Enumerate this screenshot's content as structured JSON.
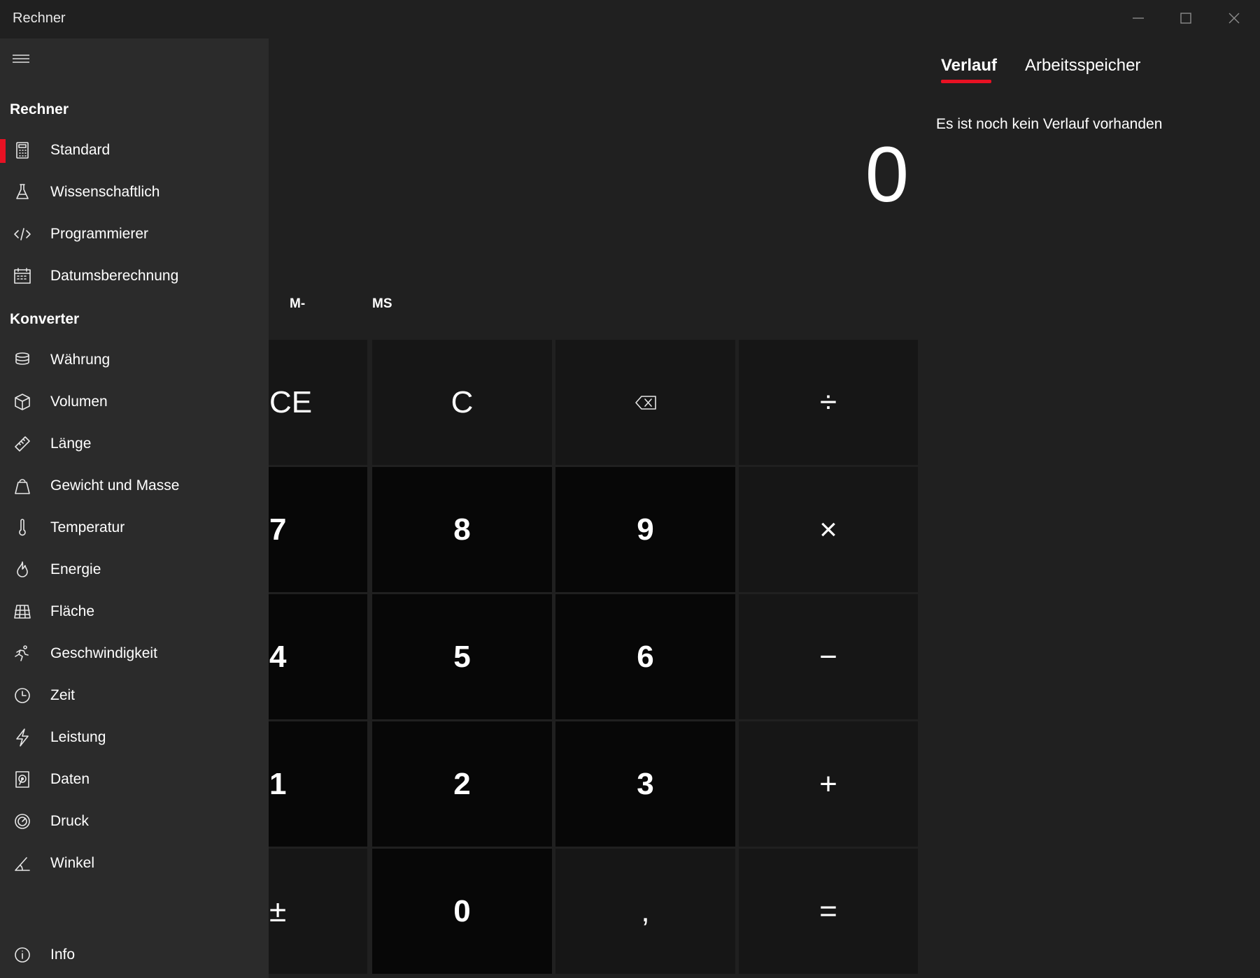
{
  "window": {
    "title": "Rechner"
  },
  "sidebar": {
    "sections": [
      {
        "heading": "Rechner"
      },
      {
        "heading": "Konverter"
      }
    ],
    "calculators": [
      {
        "label": "Standard",
        "icon": "calculator-icon",
        "selected": true
      },
      {
        "label": "Wissenschaftlich",
        "icon": "flask-icon"
      },
      {
        "label": "Programmierer",
        "icon": "code-icon"
      },
      {
        "label": "Datumsberechnung",
        "icon": "calendar-icon"
      }
    ],
    "converters": [
      {
        "label": "Währung",
        "icon": "currency-icon"
      },
      {
        "label": "Volumen",
        "icon": "cube-icon"
      },
      {
        "label": "Länge",
        "icon": "ruler-icon"
      },
      {
        "label": "Gewicht und Masse",
        "icon": "weight-icon"
      },
      {
        "label": "Temperatur",
        "icon": "thermometer-icon"
      },
      {
        "label": "Energie",
        "icon": "flame-icon"
      },
      {
        "label": "Fläche",
        "icon": "area-icon"
      },
      {
        "label": "Geschwindigkeit",
        "icon": "running-icon"
      },
      {
        "label": "Zeit",
        "icon": "clock-icon"
      },
      {
        "label": "Leistung",
        "icon": "lightning-icon"
      },
      {
        "label": "Daten",
        "icon": "hard-drive-icon"
      },
      {
        "label": "Druck",
        "icon": "gauge-icon"
      },
      {
        "label": "Winkel",
        "icon": "angle-icon"
      }
    ],
    "footer": {
      "label": "Info",
      "icon": "info-icon"
    }
  },
  "calculator": {
    "display": "0",
    "memory": [
      "M-",
      "MS"
    ],
    "keys": [
      {
        "label": "CE",
        "kind": "fn"
      },
      {
        "label": "C",
        "kind": "fn"
      },
      {
        "label": "",
        "icon": "backspace-icon",
        "kind": "fn"
      },
      {
        "label": "÷",
        "kind": "fn"
      },
      {
        "label": "7",
        "kind": "num"
      },
      {
        "label": "8",
        "kind": "num"
      },
      {
        "label": "9",
        "kind": "num"
      },
      {
        "label": "×",
        "kind": "fn"
      },
      {
        "label": "4",
        "kind": "num"
      },
      {
        "label": "5",
        "kind": "num"
      },
      {
        "label": "6",
        "kind": "num"
      },
      {
        "label": "−",
        "kind": "fn"
      },
      {
        "label": "1",
        "kind": "num"
      },
      {
        "label": "2",
        "kind": "num"
      },
      {
        "label": "3",
        "kind": "num"
      },
      {
        "label": "+",
        "kind": "fn"
      },
      {
        "label": "±",
        "kind": "fn"
      },
      {
        "label": "0",
        "kind": "num"
      },
      {
        "label": ",",
        "kind": "fn"
      },
      {
        "label": "=",
        "kind": "fn"
      }
    ]
  },
  "history": {
    "tabs": [
      {
        "label": "Verlauf",
        "active": true
      },
      {
        "label": "Arbeitsspeicher",
        "active": false
      }
    ],
    "empty_message": "Es ist noch kein Verlauf vorhanden"
  },
  "colors": {
    "accent": "#e81123",
    "background": "#202020",
    "sidebar": "#2b2b2b",
    "number_key": "#070707",
    "function_key": "#161616"
  }
}
